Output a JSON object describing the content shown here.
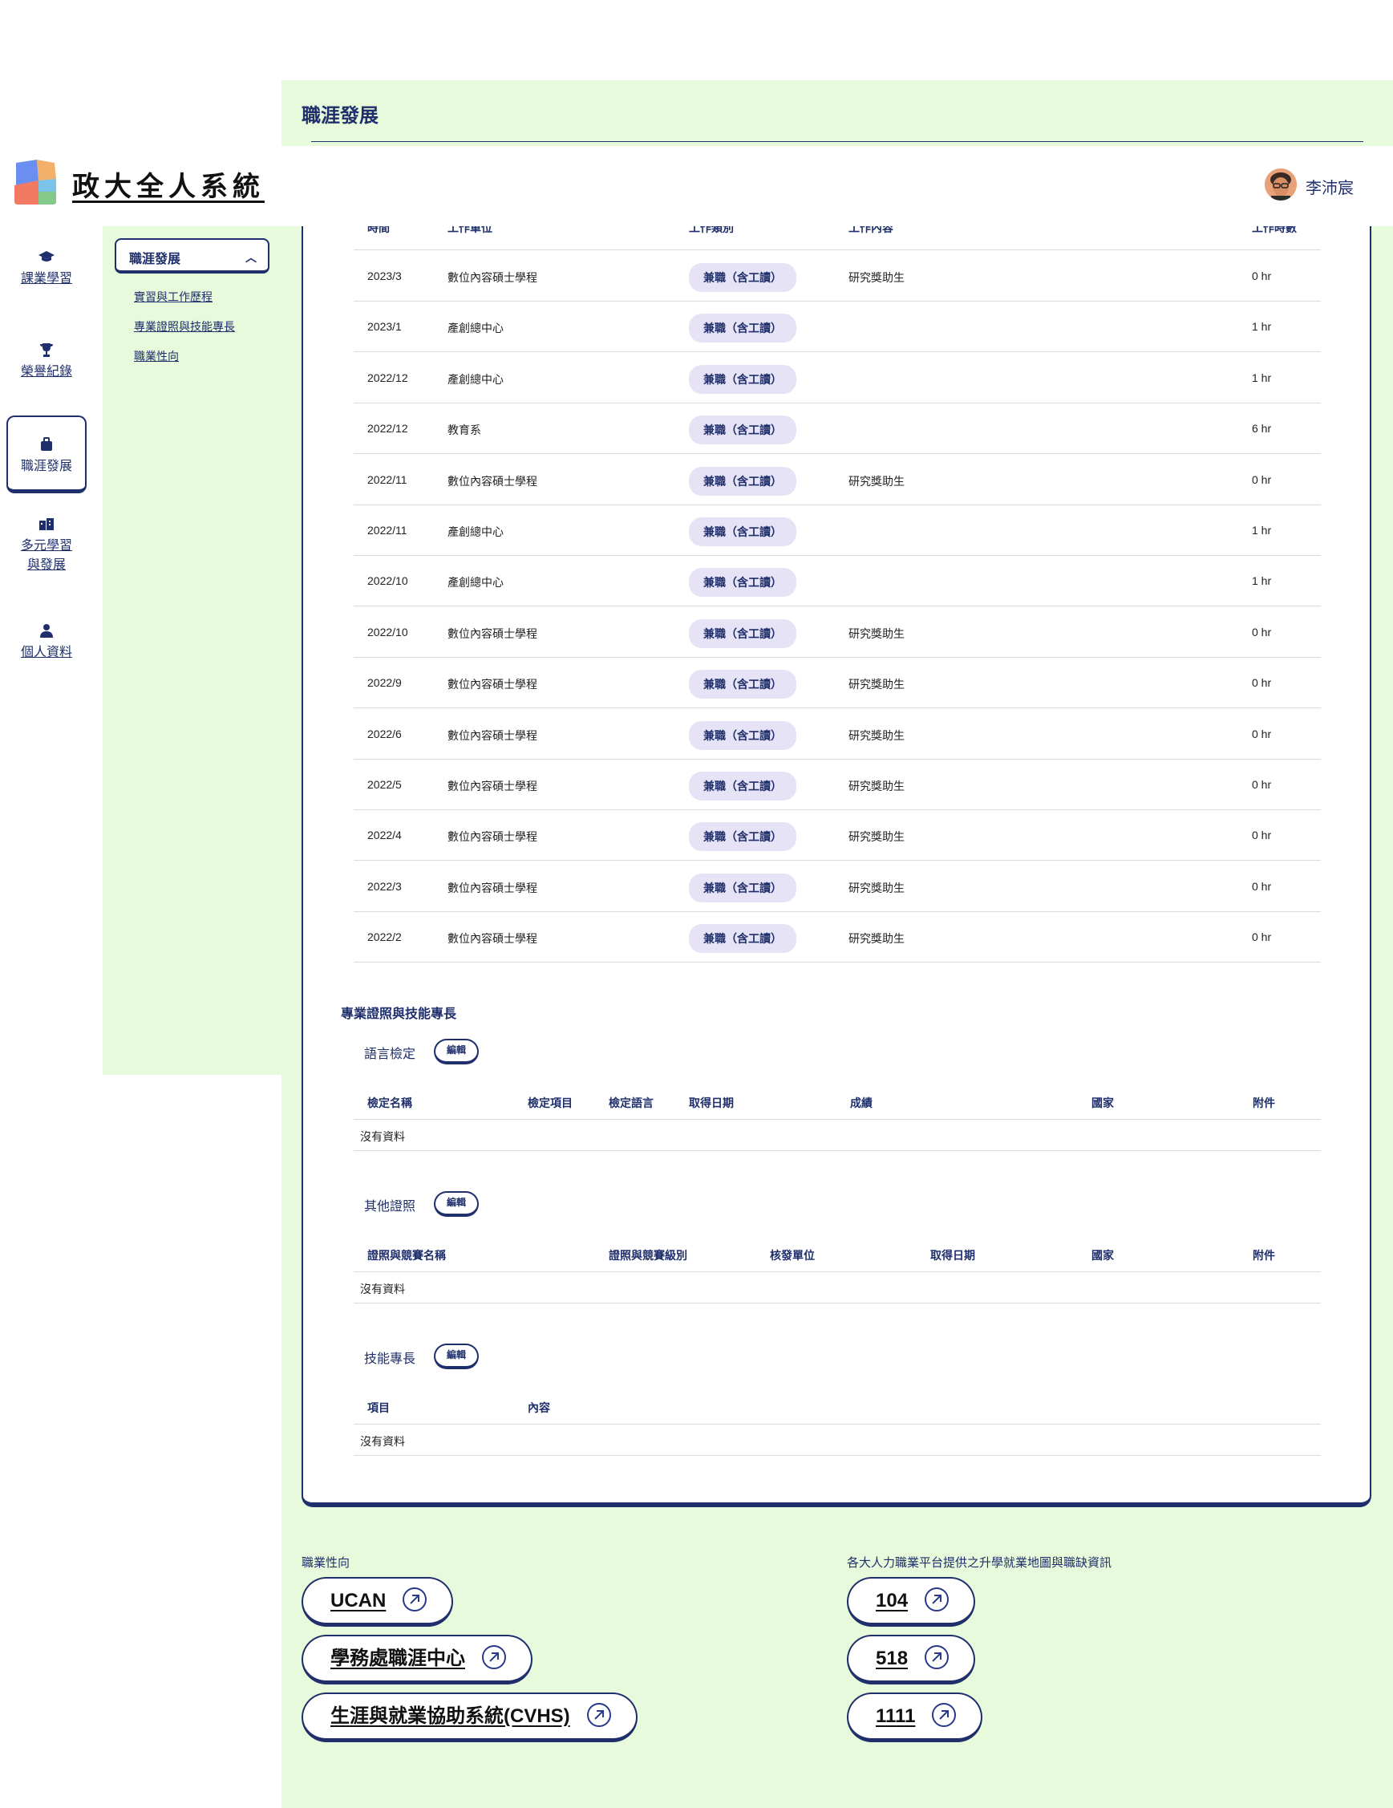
{
  "page": {
    "title": "職涯發展"
  },
  "header": {
    "app_title": "政大全人系統",
    "user_name": "李沛宸"
  },
  "nav": {
    "items": [
      {
        "label": "課業學習",
        "icon": "graduation-cap-icon"
      },
      {
        "label": "榮譽紀錄",
        "icon": "trophy-icon"
      },
      {
        "label": "職涯發展",
        "icon": "briefcase-icon"
      },
      {
        "label": "多元學習",
        "label2": "與發展",
        "icon": "buildings-icon"
      },
      {
        "label": "個人資料",
        "icon": "person-icon"
      }
    ]
  },
  "subnav": {
    "header": "職涯發展",
    "links": [
      "實習與工作歷程",
      "專業證照與技能專長",
      "職業性向"
    ]
  },
  "work_table": {
    "headers": [
      "時間",
      "工作單位",
      "工作類別",
      "工作內容",
      "工作時數"
    ],
    "rows": [
      {
        "time": "2023/3",
        "unit": "數位內容碩士學程",
        "type": "兼職（含工讀）",
        "content": "研究獎助生",
        "hours": "0 hr"
      },
      {
        "time": "2023/1",
        "unit": "產創總中心",
        "type": "兼職（含工讀）",
        "content": "",
        "hours": "1 hr"
      },
      {
        "time": "2022/12",
        "unit": "產創總中心",
        "type": "兼職（含工讀）",
        "content": "",
        "hours": "1 hr"
      },
      {
        "time": "2022/12",
        "unit": "教育系",
        "type": "兼職（含工讀）",
        "content": "",
        "hours": "6 hr"
      },
      {
        "time": "2022/11",
        "unit": "數位內容碩士學程",
        "type": "兼職（含工讀）",
        "content": "研究獎助生",
        "hours": "0 hr"
      },
      {
        "time": "2022/11",
        "unit": "產創總中心",
        "type": "兼職（含工讀）",
        "content": "",
        "hours": "1 hr"
      },
      {
        "time": "2022/10",
        "unit": "產創總中心",
        "type": "兼職（含工讀）",
        "content": "",
        "hours": "1 hr"
      },
      {
        "time": "2022/10",
        "unit": "數位內容碩士學程",
        "type": "兼職（含工讀）",
        "content": "研究獎助生",
        "hours": "0 hr"
      },
      {
        "time": "2022/9",
        "unit": "數位內容碩士學程",
        "type": "兼職（含工讀）",
        "content": "研究獎助生",
        "hours": "0 hr"
      },
      {
        "time": "2022/6",
        "unit": "數位內容碩士學程",
        "type": "兼職（含工讀）",
        "content": "研究獎助生",
        "hours": "0 hr"
      },
      {
        "time": "2022/5",
        "unit": "數位內容碩士學程",
        "type": "兼職（含工讀）",
        "content": "研究獎助生",
        "hours": "0 hr"
      },
      {
        "time": "2022/4",
        "unit": "數位內容碩士學程",
        "type": "兼職（含工讀）",
        "content": "研究獎助生",
        "hours": "0 hr"
      },
      {
        "time": "2022/3",
        "unit": "數位內容碩士學程",
        "type": "兼職（含工讀）",
        "content": "研究獎助生",
        "hours": "0 hr"
      },
      {
        "time": "2022/2",
        "unit": "數位內容碩士學程",
        "type": "兼職（含工讀）",
        "content": "研究獎助生",
        "hours": "0 hr"
      }
    ]
  },
  "certs": {
    "title": "專業證照與技能專長",
    "edit_label": "編輯",
    "empty_label": "沒有資料",
    "language": {
      "label": "語言檢定",
      "headers": [
        "檢定名稱",
        "檢定項目",
        "檢定語言",
        "取得日期",
        "成績",
        "國家",
        "附件"
      ]
    },
    "other": {
      "label": "其他證照",
      "headers": [
        "證照與競賽名稱",
        "證照與競賽級別",
        "核發單位",
        "取得日期",
        "國家",
        "附件"
      ]
    },
    "skills": {
      "label": "技能專長",
      "headers": [
        "項目",
        "內容"
      ]
    }
  },
  "career_links": {
    "title": "職業性向",
    "items": [
      "UCAN",
      "學務處職涯中心",
      "生涯與就業協助系統(CVHS)"
    ]
  },
  "job_links": {
    "title": "各大人力職業平台提供之升學就業地圖與職缺資訊",
    "items": [
      "104",
      "518",
      "1111"
    ]
  },
  "colors": {
    "accent": "#1f2f6b",
    "panel_bg": "#e8fadc",
    "chip_bg": "#e6e3f7"
  }
}
